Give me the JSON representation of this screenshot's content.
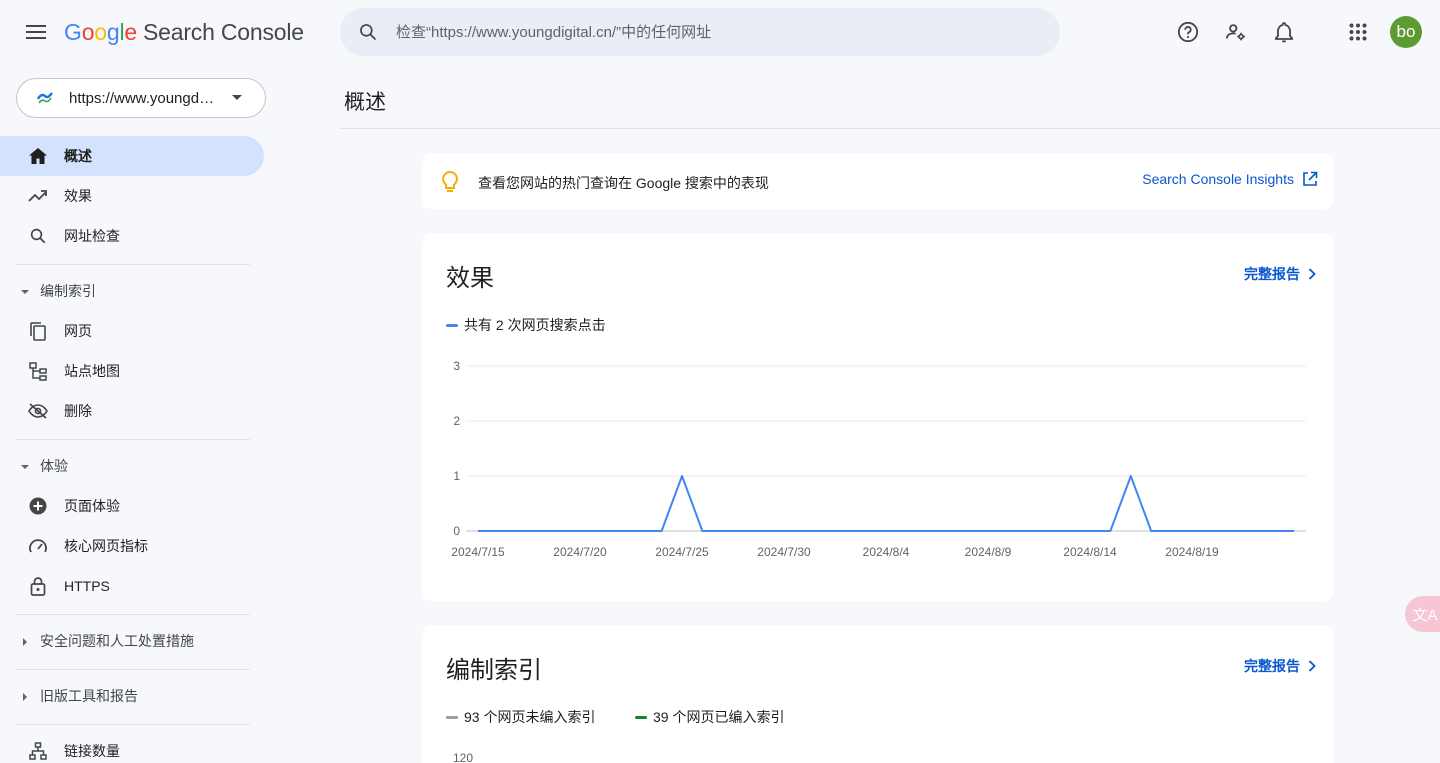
{
  "header": {
    "logo_google": [
      "G",
      "o",
      "o",
      "g",
      "l",
      "e"
    ],
    "logo_product": "Search Console",
    "search_placeholder": "检查“https://www.youngdigital.cn/”中的任何网址",
    "avatar_text": "bo"
  },
  "sidebar": {
    "property_label": "https://www.youngd…",
    "items_top": [
      {
        "label": "概述",
        "icon": "home-icon",
        "active": true
      },
      {
        "label": "效果",
        "icon": "trending-up-icon"
      },
      {
        "label": "网址检查",
        "icon": "search-icon"
      }
    ],
    "section_indexing": "编制索引",
    "items_indexing": [
      {
        "label": "网页",
        "icon": "pages-icon"
      },
      {
        "label": "站点地图",
        "icon": "sitemap-icon"
      },
      {
        "label": "删除",
        "icon": "visibility-off-icon"
      }
    ],
    "section_experience": "体验",
    "items_experience": [
      {
        "label": "页面体验",
        "icon": "add-circle-icon"
      },
      {
        "label": "核心网页指标",
        "icon": "speed-icon"
      },
      {
        "label": "HTTPS",
        "icon": "lock-icon"
      }
    ],
    "section_security": "安全问题和人工处置措施",
    "section_legacy": "旧版工具和报告",
    "item_links": {
      "label": "链接数量",
      "icon": "links-icon"
    }
  },
  "main": {
    "page_title": "概述",
    "insight_text": "查看您网站的热门查询在 Google 搜索中的表现",
    "insight_link": "Search Console Insights",
    "performance": {
      "title": "效果",
      "full_report": "完整报告",
      "legend": "共有 2 次网页搜索点击"
    },
    "indexing": {
      "title": "编制索引",
      "full_report": "完整报告",
      "legend_not_indexed": "93 个网页未编入索引",
      "legend_indexed": "39 个网页已编入索引",
      "y_top_tick": "120"
    }
  },
  "colors": {
    "accent": "#0b57d0",
    "active_nav": "#d3e3fd",
    "clicks_line": "#4285f4",
    "not_indexed": "#9aa0a6",
    "indexed": "#188038",
    "avatar": "#5c9b32"
  },
  "float_button": "文A",
  "chart_data": {
    "type": "line",
    "title": "",
    "xlabel": "",
    "ylabel": "",
    "ylim": [
      0,
      3
    ],
    "yticks": [
      "0",
      "1",
      "2",
      "3"
    ],
    "xtick_labels": [
      "2024/7/15",
      "2024/7/20",
      "2024/7/25",
      "2024/7/30",
      "2024/8/4",
      "2024/8/9",
      "2024/8/14",
      "2024/8/19"
    ],
    "grid": true,
    "x": [
      "2024/7/15",
      "2024/7/16",
      "2024/7/17",
      "2024/7/18",
      "2024/7/19",
      "2024/7/20",
      "2024/7/21",
      "2024/7/22",
      "2024/7/23",
      "2024/7/24",
      "2024/7/25",
      "2024/7/26",
      "2024/7/27",
      "2024/7/28",
      "2024/7/29",
      "2024/7/30",
      "2024/7/31",
      "2024/8/1",
      "2024/8/2",
      "2024/8/3",
      "2024/8/4",
      "2024/8/5",
      "2024/8/6",
      "2024/8/7",
      "2024/8/8",
      "2024/8/9",
      "2024/8/10",
      "2024/8/11",
      "2024/8/12",
      "2024/8/13",
      "2024/8/14",
      "2024/8/15",
      "2024/8/16",
      "2024/8/17",
      "2024/8/18",
      "2024/8/19",
      "2024/8/20",
      "2024/8/21",
      "2024/8/22",
      "2024/8/23",
      "2024/8/24"
    ],
    "series": [
      {
        "values": [
          0,
          0,
          0,
          0,
          0,
          0,
          0,
          0,
          0,
          0,
          1,
          0,
          0,
          0,
          0,
          0,
          0,
          0,
          0,
          0,
          0,
          0,
          0,
          0,
          0,
          0,
          0,
          0,
          0,
          0,
          0,
          0,
          1,
          0,
          0,
          0,
          0,
          0,
          0,
          0,
          0
        ]
      }
    ]
  }
}
